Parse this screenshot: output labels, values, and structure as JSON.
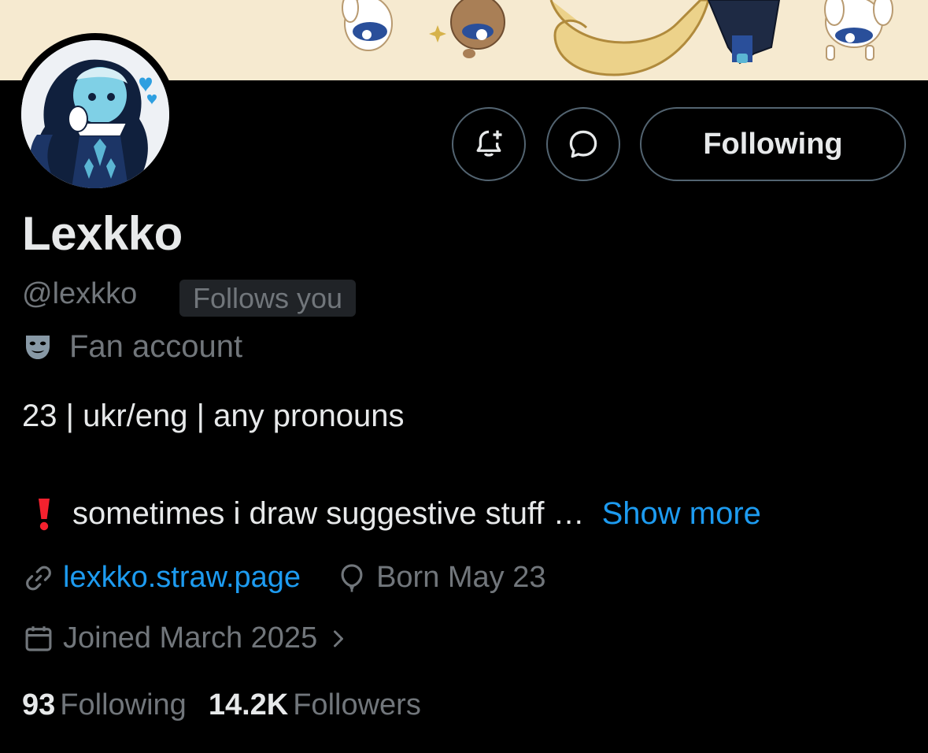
{
  "profile": {
    "display_name": "Lexkko",
    "handle": "@lexkko",
    "follows_you_badge": "Follows you",
    "category": "Fan account",
    "bio_line1": "23 | ukr/eng | any pronouns",
    "bio_line2": "sometimes i draw suggestive stuff …",
    "show_more": "Show more",
    "website": "lexkko.straw.page",
    "birthday": "Born May 23",
    "joined": "Joined March 2025",
    "following_count": "93",
    "following_label": "Following",
    "followers_count": "14.2K",
    "followers_label": "Followers"
  },
  "actions": {
    "following_button": "Following"
  },
  "icons": {
    "notify": "bell-plus-icon",
    "message": "chat-bubble-icon",
    "category": "theater-mask-icon",
    "warning": "exclamation-icon",
    "link": "link-icon",
    "birthday": "balloon-icon",
    "joined": "calendar-icon",
    "joined_more": "chevron-right-icon"
  },
  "colors": {
    "background": "#000000",
    "primary_text": "#e7e9ea",
    "secondary_text": "#71767b",
    "accent": "#1d9bf0",
    "border": "#536471",
    "badge_bg": "#202327",
    "warning": "#f4212e",
    "banner_bg": "#f6ead0"
  }
}
